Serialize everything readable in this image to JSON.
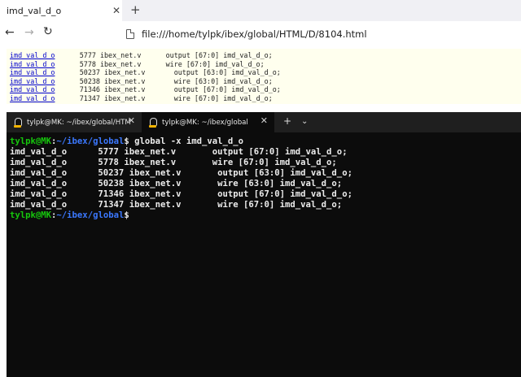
{
  "browser": {
    "tab_title": "imd_val_d_o",
    "close_glyph": "✕",
    "new_tab_glyph": "+",
    "back_glyph": "←",
    "forward_glyph": "→",
    "reload_glyph": "↻",
    "url": "file:///home/tylpk/ibex/global/HTML/D/8104.html"
  },
  "page": {
    "rows": [
      {
        "symbol": "imd_val_d_o",
        "line": "5777",
        "file": "ibex_net.v",
        "code": "  output [67:0] imd_val_d_o;"
      },
      {
        "symbol": "imd_val_d_o",
        "line": "5778",
        "file": "ibex_net.v",
        "code": "  wire [67:0] imd_val_d_o;"
      },
      {
        "symbol": "imd_val_d_o",
        "line": "50237",
        "file": "ibex_net.v",
        "code": "   output [63:0] imd_val_d_o;"
      },
      {
        "symbol": "imd_val_d_o",
        "line": "50238",
        "file": "ibex_net.v",
        "code": "   wire [63:0] imd_val_d_o;"
      },
      {
        "symbol": "imd_val_d_o",
        "line": "71346",
        "file": "ibex_net.v",
        "code": "   output [67:0] imd_val_d_o;"
      },
      {
        "symbol": "imd_val_d_o",
        "line": "71347",
        "file": "ibex_net.v",
        "code": "   wire [67:0] imd_val_d_o;"
      }
    ]
  },
  "terminal": {
    "tabs": [
      {
        "title": "tylpk@MK: ~/ibex/global/HTM"
      },
      {
        "title": "tylpk@MK: ~/ibex/global"
      }
    ],
    "close_glyph": "✕",
    "new_tab_glyph": "+",
    "dropdown_glyph": "⌄",
    "prompt_user": "tylpk@MK",
    "prompt_colon": ":",
    "prompt_path": "~/ibex/global",
    "prompt_dollar": "$",
    "command": " global -x imd_val_d_o",
    "output": [
      "imd_val_d_o      5777 ibex_net.v       output [67:0] imd_val_d_o;",
      "imd_val_d_o      5778 ibex_net.v       wire [67:0] imd_val_d_o;",
      "imd_val_d_o      50237 ibex_net.v       output [63:0] imd_val_d_o;",
      "imd_val_d_o      50238 ibex_net.v       wire [63:0] imd_val_d_o;",
      "imd_val_d_o      71346 ibex_net.v       output [67:0] imd_val_d_o;",
      "imd_val_d_o      71347 ibex_net.v       wire [67:0] imd_val_d_o;"
    ]
  }
}
